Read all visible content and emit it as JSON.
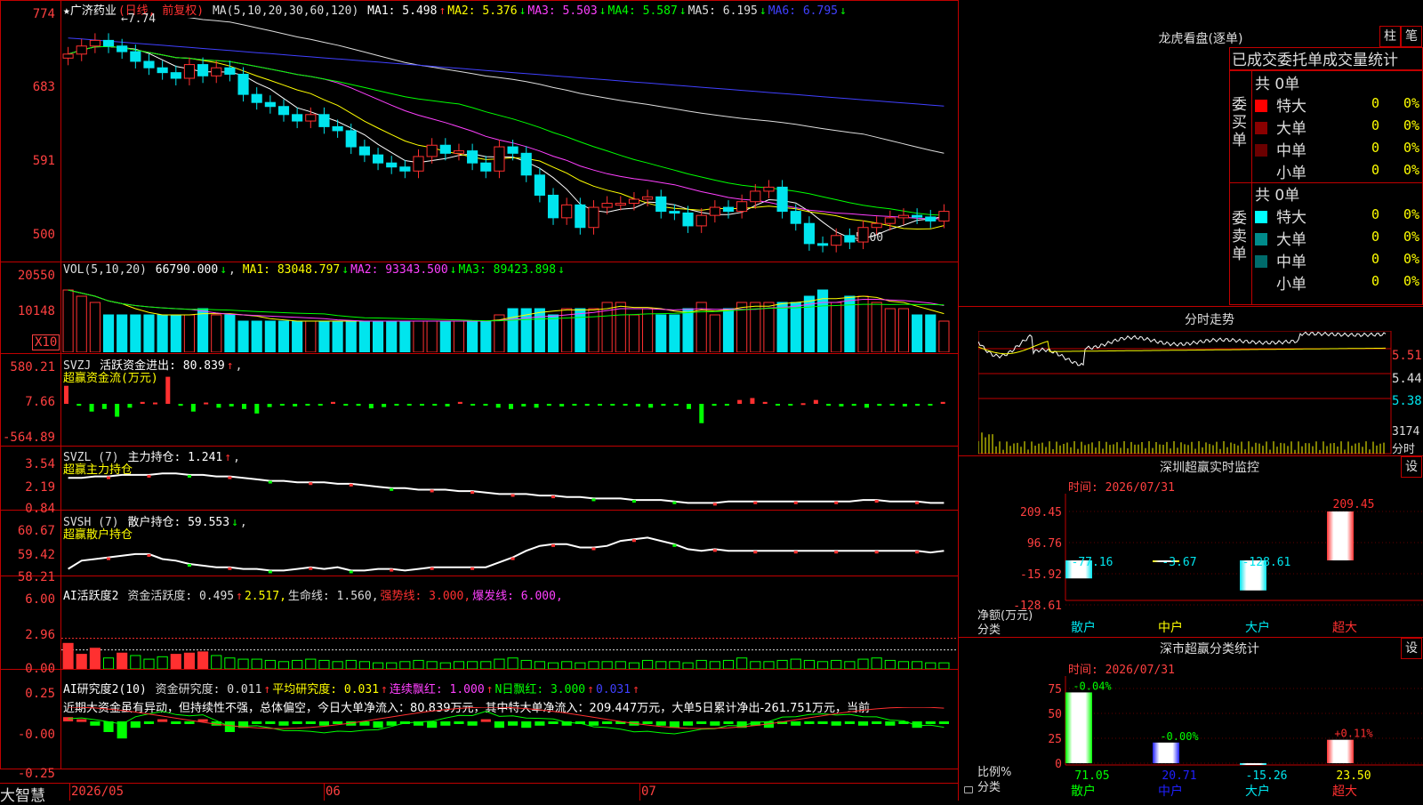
{
  "app": {
    "brand": "大智慧"
  },
  "colors": {
    "up": "#ff3030",
    "down": "#00e5ee",
    "green": "#00ff00",
    "yellow": "#ffff00",
    "magenta": "#ff40ff",
    "blue": "#4040ff",
    "white": "#ffffff",
    "grid": "#c00000",
    "label": "#ff4040"
  },
  "kline": {
    "title": "★广济药业",
    "mode": "(日线, 前复权)",
    "ma_label": "MA(5,10,20,30,60,120)",
    "ma": [
      {
        "label": "MA1: 5.498",
        "arrow": "↑",
        "color": "#ffffff"
      },
      {
        "label": "MA2: 5.376",
        "arrow": "↓",
        "color": "#ffff00"
      },
      {
        "label": "MA3: 5.503",
        "arrow": "↓",
        "color": "#ff40ff"
      },
      {
        "label": "MA4: 5.587",
        "arrow": "↓",
        "color": "#00ff00"
      },
      {
        "label": "MA5: 6.195",
        "arrow": "↓",
        "color": "#dddddd"
      },
      {
        "label": "MA6: 6.795",
        "arrow": "↓",
        "color": "#4040ff"
      }
    ],
    "yticks": [
      "774",
      "683",
      "591",
      "500"
    ],
    "high_mark": "7.74",
    "low_mark": "5.00",
    "closes": [
      7.45,
      7.55,
      7.62,
      7.55,
      7.48,
      7.36,
      7.28,
      7.22,
      7.15,
      7.32,
      7.18,
      7.28,
      7.2,
      6.95,
      6.85,
      6.8,
      6.7,
      6.62,
      6.7,
      6.55,
      6.5,
      6.3,
      6.2,
      6.1,
      6.05,
      6.0,
      6.18,
      6.32,
      6.22,
      6.25,
      6.1,
      6.0,
      6.3,
      6.22,
      5.95,
      5.7,
      5.42,
      5.58,
      5.3,
      5.55,
      5.6,
      5.6,
      5.65,
      5.68,
      5.5,
      5.48,
      5.32,
      5.45,
      5.55,
      5.5,
      5.62,
      5.75,
      5.8,
      5.5,
      5.35,
      5.1,
      5.08,
      5.2,
      5.12,
      5.3,
      5.35,
      5.42,
      5.45,
      5.43,
      5.38,
      5.5
    ]
  },
  "volume": {
    "label": "VOL(5,10,20)",
    "value": "66790.000",
    "value_arrow": "↓",
    "ma": [
      {
        "label": "MA1: 83048.797",
        "arrow": "↓",
        "color": "#ffff00"
      },
      {
        "label": "MA2: 93343.500",
        "arrow": "↓",
        "color": "#ff40ff"
      },
      {
        "label": "MA3: 89423.898",
        "arrow": "↓",
        "color": "#00ff00"
      }
    ],
    "yticks": [
      "20550",
      "10148"
    ],
    "unit": "X10",
    "values": [
      10,
      9,
      8,
      6,
      6,
      6,
      6,
      6,
      6,
      6,
      7,
      6,
      6,
      5,
      5,
      5,
      5,
      5,
      5,
      5,
      5,
      5,
      5,
      5,
      5,
      5,
      5,
      5,
      5,
      5,
      5,
      5,
      6,
      7,
      7,
      7,
      6,
      7,
      7,
      7,
      8,
      8,
      6,
      7,
      6,
      6,
      7,
      8,
      6,
      7,
      8,
      8,
      8,
      8,
      8,
      9,
      10,
      8,
      9,
      9,
      8,
      7,
      7,
      6,
      6,
      5
    ]
  },
  "svzj": {
    "label": "SVZJ",
    "title": "活跃资金进出: 80.839",
    "arrow": "↑",
    "sub": "超赢资金流(万元)",
    "yticks": [
      "580.21",
      "7.66",
      "-564.89"
    ],
    "values": [
      280,
      -30,
      -120,
      -80,
      -200,
      -60,
      30,
      20,
      420,
      -30,
      -120,
      20,
      -60,
      -40,
      -80,
      -150,
      -50,
      -10,
      -40,
      -20,
      -10,
      30,
      -20,
      -30,
      -70,
      -50,
      -10,
      -10,
      -20,
      -20,
      -40,
      30,
      -20,
      -10,
      -60,
      -80,
      -40,
      -60,
      -30,
      -40,
      -20,
      -30,
      -20,
      -10,
      -20,
      -40,
      -60,
      -30,
      -20,
      -80,
      -300,
      -30,
      -20,
      60,
      90,
      30,
      -10,
      -20,
      10,
      60,
      -30,
      -40,
      -30,
      -60,
      -30,
      -20,
      -40,
      -30,
      -20,
      30
    ]
  },
  "svzl": {
    "label": "SVZL (7)",
    "title": "主力持仓: 1.241",
    "arrow": "↑",
    "sub": "超赢主力持仓",
    "yticks": [
      "3.54",
      "2.19",
      "0.84"
    ],
    "values": [
      2.9,
      2.9,
      3.0,
      3.0,
      3.1,
      3.1,
      3.1,
      3.2,
      3.2,
      3.1,
      3.1,
      3.0,
      3.0,
      2.9,
      2.8,
      2.7,
      2.7,
      2.6,
      2.6,
      2.6,
      2.5,
      2.5,
      2.4,
      2.3,
      2.2,
      2.2,
      2.1,
      2.1,
      2.1,
      2.0,
      2.0,
      1.9,
      1.8,
      1.8,
      1.8,
      1.7,
      1.7,
      1.6,
      1.6,
      1.5,
      1.5,
      1.5,
      1.4,
      1.4,
      1.4,
      1.3,
      1.2,
      1.2,
      1.2,
      1.3,
      1.3,
      1.3,
      1.3,
      1.3,
      1.3,
      1.3,
      1.3,
      1.3,
      1.3,
      1.4,
      1.4,
      1.3,
      1.3,
      1.3,
      1.2,
      1.2
    ]
  },
  "svsh": {
    "label": "SVSH (7)",
    "title": "散户持仓: 59.553",
    "arrow": "↓",
    "sub": "超赢散户持仓",
    "yticks": [
      "60.67",
      "59.42",
      "58.21"
    ],
    "values": [
      58.5,
      59.0,
      59.1,
      59.2,
      59.3,
      59.4,
      59.4,
      59.1,
      59.0,
      58.8,
      58.7,
      58.6,
      58.6,
      58.5,
      58.5,
      58.4,
      58.4,
      58.5,
      58.6,
      58.5,
      58.6,
      58.4,
      58.4,
      58.5,
      58.5,
      58.4,
      58.5,
      58.6,
      58.6,
      58.6,
      58.6,
      58.6,
      58.9,
      59.2,
      59.6,
      59.9,
      60.0,
      60.0,
      59.8,
      59.8,
      59.9,
      60.2,
      60.3,
      60.4,
      60.2,
      60.0,
      59.7,
      59.6,
      59.7,
      59.6,
      59.6,
      59.6,
      59.6,
      59.6,
      59.6,
      59.6,
      59.6,
      59.6,
      59.6,
      59.6,
      59.6,
      59.6,
      59.6,
      59.6,
      59.5,
      59.6
    ]
  },
  "ai_active": {
    "label": "AI活跃度2",
    "fields": [
      {
        "label": "资金活跃度: 0.495",
        "arrow": "↑",
        "color": "#dddddd"
      },
      {
        "label": "2.517,",
        "arrow": "",
        "color": "#ffff00"
      },
      {
        "label": "生命线: 1.560,",
        "arrow": "",
        "color": "#dddddd"
      },
      {
        "label": "强势线: 3.000,",
        "arrow": "",
        "color": "#ff3030"
      },
      {
        "label": "爆发线: 6.000,",
        "arrow": "",
        "color": "#ff40ff"
      }
    ],
    "yticks": [
      "6.00",
      "2.96",
      "0.00"
    ],
    "values": [
      2.1,
      1.2,
      1.7,
      0.9,
      1.3,
      1.1,
      0.8,
      1.0,
      1.2,
      1.3,
      1.4,
      1.1,
      0.9,
      0.8,
      0.8,
      0.7,
      0.6,
      0.7,
      0.8,
      0.7,
      0.6,
      0.7,
      0.6,
      0.5,
      0.5,
      0.6,
      0.7,
      0.6,
      0.5,
      0.6,
      0.6,
      0.6,
      0.8,
      0.9,
      0.7,
      0.6,
      0.5,
      0.6,
      0.5,
      0.6,
      0.6,
      0.6,
      0.5,
      0.7,
      0.6,
      0.6,
      0.5,
      0.7,
      0.6,
      0.7,
      0.9,
      0.6,
      0.6,
      0.7,
      0.8,
      0.7,
      0.6,
      0.7,
      0.6,
      0.8,
      0.9,
      0.7,
      0.6,
      0.6,
      0.5,
      0.5
    ]
  },
  "ai_research": {
    "label": "AI研究度2(10)",
    "fields": [
      {
        "label": "资金研究度: 0.011",
        "arrow": "↑",
        "color": "#dddddd"
      },
      {
        "label": "平均研究度: 0.031",
        "arrow": "↑",
        "color": "#ffff00"
      },
      {
        "label": "连续飘红: 1.000",
        "arrow": "↑",
        "color": "#ff40ff"
      },
      {
        "label": "N日飘红: 3.000",
        "arrow": "↑",
        "color": "#00ff00"
      },
      {
        "label": "0.031",
        "arrow": "↑",
        "color": "#4040ff"
      }
    ],
    "comment": "近期大资金虽有异动，但持续性不强，总体偏空，今日大单净流入：80.839万元，其中特大单净流入：209.447万元，大单5日累计净出-261.751万元，当前",
    "yticks": [
      "0.25",
      "-0.00",
      "-0.25"
    ],
    "values": [
      0.02,
      0.01,
      -0.02,
      -0.05,
      -0.08,
      -0.03,
      -0.01,
      0.01,
      -0.01,
      -0.01,
      0.01,
      -0.02,
      -0.05,
      -0.03,
      -0.01,
      -0.01,
      -0.02,
      -0.01,
      -0.01,
      -0.02,
      -0.01,
      -0.02,
      -0.02,
      -0.03,
      -0.02,
      -0.01,
      -0.02,
      -0.03,
      -0.02,
      -0.01,
      -0.02,
      0.01,
      -0.03,
      -0.02,
      -0.03,
      -0.02,
      -0.01,
      -0.02,
      -0.01,
      -0.02,
      -0.01,
      -0.01,
      -0.02,
      -0.01,
      -0.02,
      -0.03,
      -0.02,
      -0.01,
      -0.02,
      -0.01,
      -0.03,
      -0.02,
      -0.03,
      -0.01,
      -0.02,
      -0.01,
      -0.01,
      -0.02,
      -0.01,
      -0.02,
      -0.01,
      -0.02,
      -0.01,
      -0.03,
      -0.01,
      -0.01
    ]
  },
  "xaxis": {
    "labels": [
      "2026/05",
      "06",
      "07"
    ]
  },
  "longhu": {
    "title": "龙虎看盘(逐单)",
    "tabs": [
      "柱",
      "笔"
    ],
    "header": "已成交委托单成交量统计",
    "buy": {
      "label": "委买单",
      "total": "共 0单",
      "rows": [
        {
          "name": "特大",
          "count": "0",
          "pct": "0%",
          "color": "#ff0000"
        },
        {
          "name": "大单",
          "count": "0",
          "pct": "0%",
          "color": "#8b0000"
        },
        {
          "name": "中单",
          "count": "0",
          "pct": "0%",
          "color": "#6b0000"
        },
        {
          "name": "小单",
          "count": "0",
          "pct": "0%",
          "color": "#000000"
        }
      ]
    },
    "sell": {
      "label": "委卖单",
      "total": "共 0单",
      "rows": [
        {
          "name": "特大",
          "count": "0",
          "pct": "0%",
          "color": "#00ffff"
        },
        {
          "name": "大单",
          "count": "0",
          "pct": "0%",
          "color": "#008b8b"
        },
        {
          "name": "中单",
          "count": "0",
          "pct": "0%",
          "color": "#006b6b"
        },
        {
          "name": "小单",
          "count": "0",
          "pct": "0%",
          "color": "#000000"
        }
      ]
    }
  },
  "intraday": {
    "title": "分时走势",
    "yticks": [
      "5.51",
      "5.44",
      "5.38"
    ],
    "vol_tick": "3174",
    "vol_unit": "分时"
  },
  "sz_monitor": {
    "title": "深圳超赢实时监控",
    "set": "设",
    "time": "时间: 2026/07/31",
    "yticks": [
      "209.45",
      "96.76",
      "-15.92",
      "-128.61"
    ],
    "unit": "净额(万元)",
    "cat_label": "分类",
    "categories": [
      "散户",
      "中户",
      "大户",
      "超大"
    ],
    "values": [
      -77.16,
      -3.67,
      -128.61,
      209.45
    ],
    "value_labels": [
      "-77.16",
      "-3.67",
      "-128.61",
      "209.45"
    ]
  },
  "sz_stat": {
    "title": "深市超赢分类统计",
    "set": "设",
    "time": "时间: 2026/07/31",
    "yticks": [
      "75",
      "50",
      "25",
      "0"
    ],
    "unit": "比例%",
    "cat_label": "分类",
    "categories": [
      "散户",
      "中户",
      "大户",
      "超大"
    ],
    "values": [
      71.05,
      20.71,
      -15.26,
      23.5
    ],
    "value_labels": [
      "71.05",
      "20.71",
      "-15.26",
      "23.50"
    ],
    "changes": [
      "-0.04%",
      "-0.00%",
      "",
      "+0.11%"
    ]
  }
}
